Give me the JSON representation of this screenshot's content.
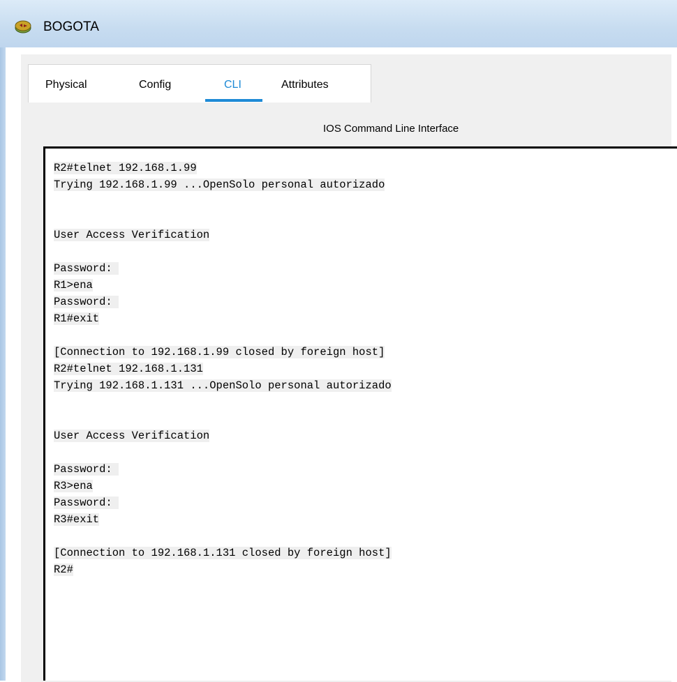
{
  "window": {
    "title": "BOGOTA",
    "icon": "router-icon"
  },
  "tabs": [
    {
      "label": "Physical",
      "active": false
    },
    {
      "label": "Config",
      "active": false
    },
    {
      "label": "CLI",
      "active": true
    },
    {
      "label": "Attributes",
      "active": false
    }
  ],
  "cli": {
    "title": "IOS Command Line Interface",
    "lines": [
      "R2#telnet 192.168.1.99",
      "Trying 192.168.1.99 ...OpenSolo personal autorizado",
      "",
      "",
      "User Access Verification",
      "",
      "Password: ",
      "R1>ena",
      "Password: ",
      "R1#exit",
      "",
      "[Connection to 192.168.1.99 closed by foreign host]",
      "R2#telnet 192.168.1.131",
      "Trying 192.168.1.131 ...OpenSolo personal autorizado",
      "",
      "",
      "User Access Verification",
      "",
      "Password: ",
      "R3>ena",
      "Password: ",
      "R3#exit",
      "",
      "[Connection to 192.168.1.131 closed by foreign host]",
      "R2#"
    ]
  },
  "colors": {
    "accent": "#1e8ad6",
    "titlebar": "#c7dcf0",
    "terminal_bg": "#ffffff",
    "text_highlight": "#efefef"
  }
}
